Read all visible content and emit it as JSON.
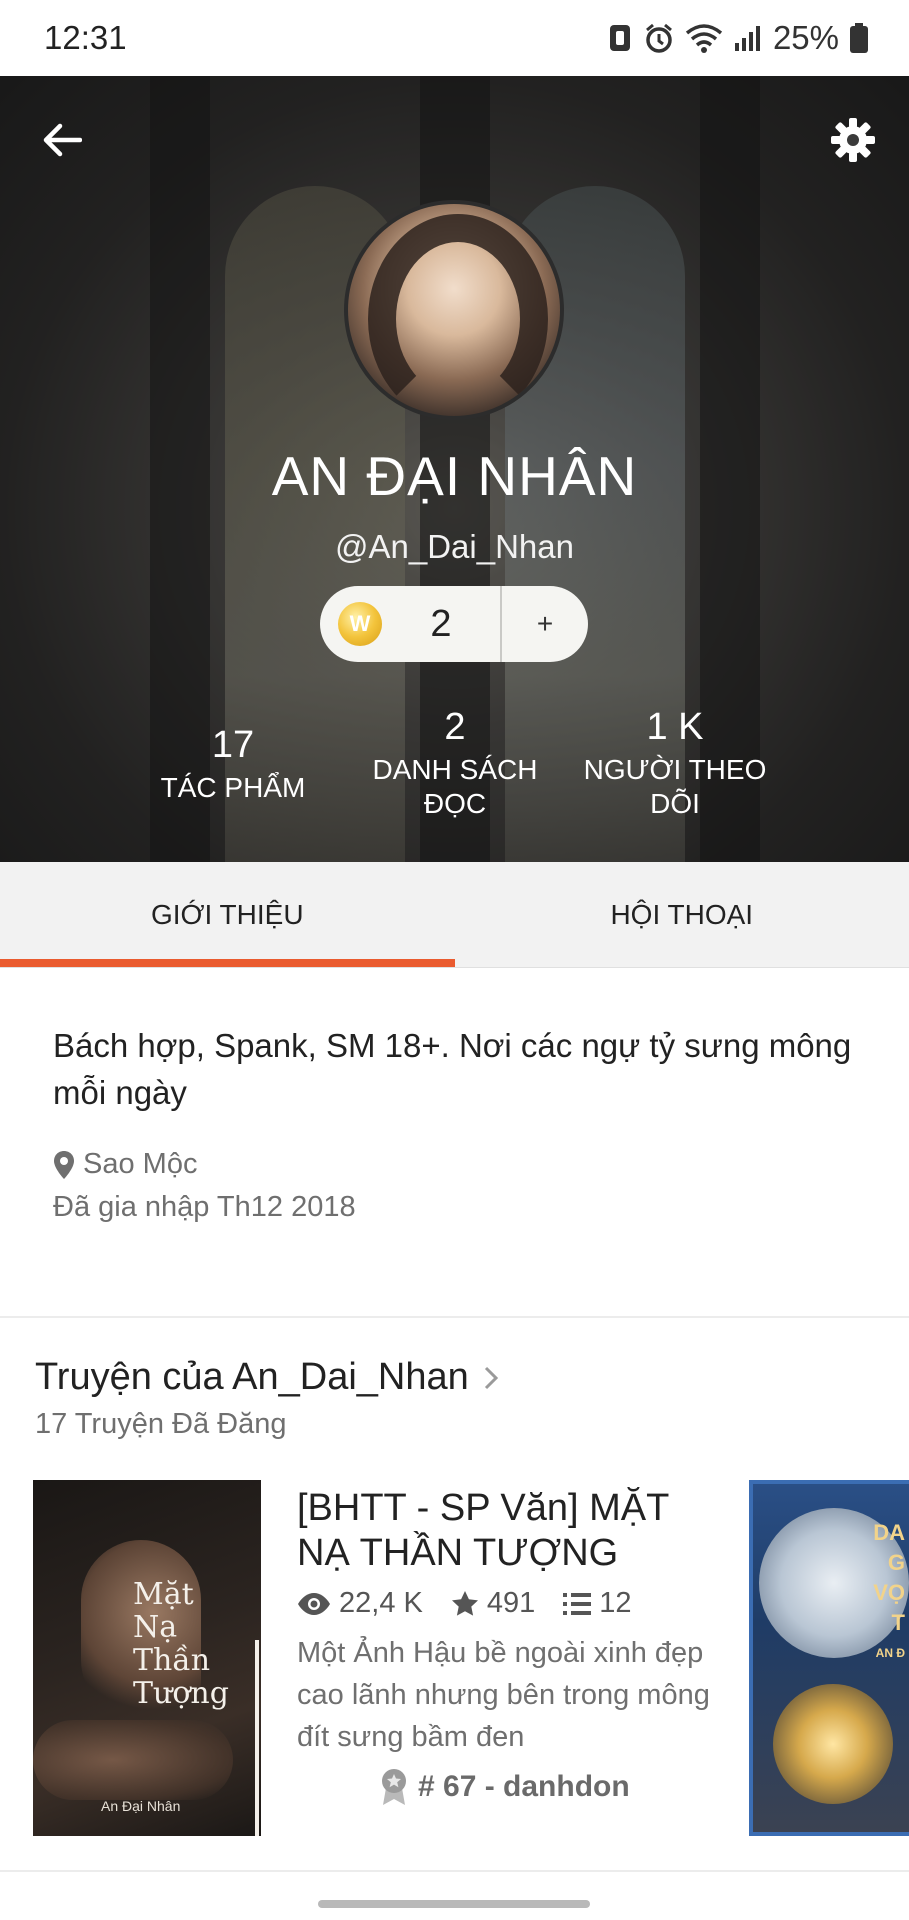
{
  "status_bar": {
    "time": "12:31",
    "battery": "25%",
    "icons": [
      "vibrate-icon",
      "alarm-icon",
      "wifi-icon",
      "signal-icon",
      "battery-icon"
    ]
  },
  "header": {
    "name": "AN ĐẠI NHÂN",
    "handle": "@An_Dai_Nhan",
    "coins": {
      "count": "2",
      "add_label": "+",
      "coin_letter": "W"
    },
    "stats": {
      "works": {
        "value": "17",
        "label": "TÁC PHẨM"
      },
      "reading_lists": {
        "value": "2",
        "label_line1": "DANH SÁCH",
        "label_line2": "ĐỌC"
      },
      "followers": {
        "value": "1 K",
        "label_line1": "NGƯỜI THEO",
        "label_line2": "DÕI"
      }
    }
  },
  "tabs": [
    {
      "label": "GIỚI THIỆU",
      "active": true
    },
    {
      "label": "HỘI THOẠI",
      "active": false
    }
  ],
  "about": {
    "bio": "Bách hợp, Spank, SM 18+. Nơi các ngự tỷ sưng mông mỗi ngày",
    "location": "Sao Mộc",
    "joined": "Đã gia nhập Th12 2018"
  },
  "stories": {
    "title": "Truyện của An_Dai_Nhan",
    "count_label": "17 Truyện Đã Đăng",
    "items": [
      {
        "title": "[BHTT - SP Văn] MẶT NẠ THẦN TƯỢNG",
        "reads": "22,4 K",
        "votes": "491",
        "parts": "12",
        "description": "Một Ảnh Hậu bề ngoài xinh đẹp cao lãnh nhưng bên trong mông đít sưng bầm đen",
        "rank": "# 67 - danhdon",
        "cover_title_lines": [
          "Mặt",
          "Nạ",
          "Thần",
          "Tượng"
        ],
        "cover_author": "An Đại Nhân"
      }
    ],
    "next_cover_text_lines": [
      "DA",
      "G",
      "VỌ",
      "T",
      "AN Đ"
    ]
  },
  "colors": {
    "accent": "#ea5b2f",
    "coin": "#f3c43c",
    "next_cover_border": "#3b6db3"
  }
}
